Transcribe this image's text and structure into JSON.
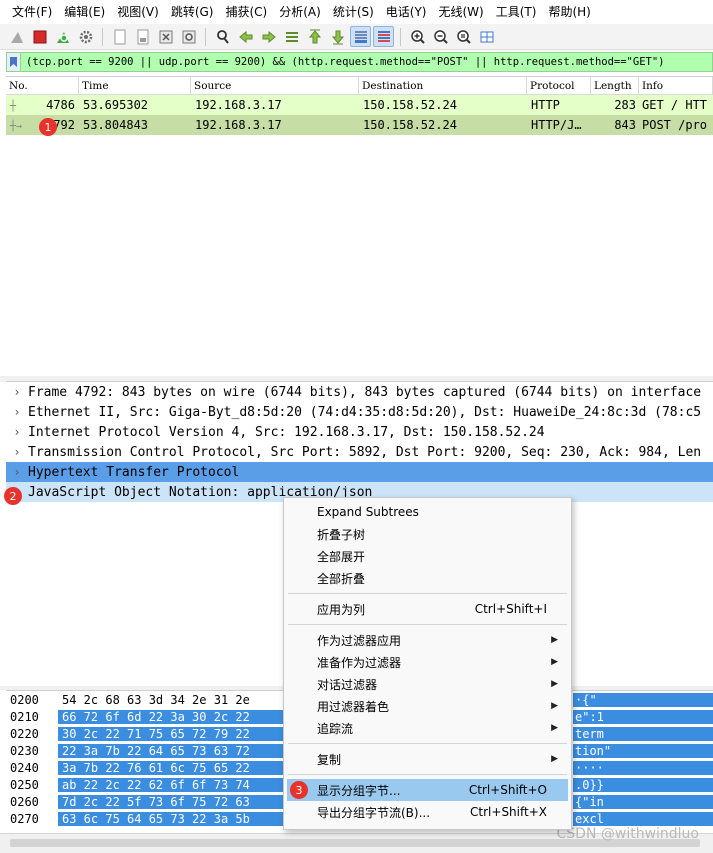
{
  "menubar": [
    "文件(F)",
    "编辑(E)",
    "视图(V)",
    "跳转(G)",
    "捕获(C)",
    "分析(A)",
    "统计(S)",
    "电话(Y)",
    "无线(W)",
    "工具(T)",
    "帮助(H)"
  ],
  "toolbar": {
    "icons": [
      "shark-fin-icon",
      "stop-icon",
      "restart-icon",
      "options-gear-icon",
      "open-file-icon",
      "save-file-icon",
      "close-file-icon",
      "reload-icon",
      "find-icon",
      "go-back-icon",
      "go-forward-icon",
      "go-to-packet-icon",
      "first-packet-icon",
      "last-packet-icon",
      "autoscroll-icon",
      "colorize-icon",
      "zoom-in-icon",
      "zoom-out-icon",
      "zoom-reset-icon",
      "resize-columns-icon"
    ]
  },
  "filter": {
    "text": "(tcp.port == 9200 || udp.port == 9200) && (http.request.method==\"POST\" ||  http.request.method==\"GET\")",
    "bg_color": "#afffaf"
  },
  "packet_list": {
    "columns": [
      "No.",
      "Time",
      "Source",
      "Destination",
      "Protocol",
      "Length",
      "Info"
    ],
    "rows": [
      {
        "no": "4786",
        "time": "53.695302",
        "source": "192.168.3.17",
        "destination": "150.158.52.24",
        "protocol": "HTTP",
        "length": "283",
        "info": "GET / HTT"
      },
      {
        "no": "4792",
        "time": "53.804843",
        "source": "192.168.3.17",
        "destination": "150.158.52.24",
        "protocol": "HTTP/J…",
        "length": "843",
        "info": "POST /pro"
      }
    ]
  },
  "details": [
    "Frame 4792: 843 bytes on wire (6744 bits), 843 bytes captured (6744 bits) on interface",
    "Ethernet II, Src: Giga-Byt_d8:5d:20 (74:d4:35:d8:5d:20), Dst: HuaweiDe_24:8c:3d (78:c5",
    "Internet Protocol Version 4, Src: 192.168.3.17, Dst: 150.158.52.24",
    "Transmission Control Protocol, Src Port: 5892, Dst Port: 9200, Seq: 230, Ack: 984, Len",
    "Hypertext Transfer Protocol",
    "JavaScript Object Notation: application/json"
  ],
  "bytes": [
    {
      "offset": "0200",
      "hex": "54 2c 68 63 3d 34 2e 31  2e",
      "ascii": "·{\""
    },
    {
      "offset": "0210",
      "hex": "66 72 6f 6d 22 3a 30 2c  22",
      "ascii": "e\":1"
    },
    {
      "offset": "0220",
      "hex": "30 2c 22 71 75 65 72 79  22",
      "ascii": "term"
    },
    {
      "offset": "0230",
      "hex": "22 3a 7b 22 64 65 73 63  72",
      "ascii": "tion\""
    },
    {
      "offset": "0240",
      "hex": "3a 7b 22 76 61 6c 75 65  22",
      "ascii": "····"
    },
    {
      "offset": "0250",
      "hex": "ab 22 2c 22 62 6f 6f 73  74",
      "ascii": ".0}}"
    },
    {
      "offset": "0260",
      "hex": "7d 2c 22 5f 73 6f 75 72  63",
      "ascii": "{\"in"
    },
    {
      "offset": "0270",
      "hex": "63 6c 75 64 65 73 22 3a  5b",
      "ascii": "excl"
    }
  ],
  "context_menu": {
    "items": [
      {
        "label": "Expand Subtrees",
        "shortcut": "",
        "submenu": false
      },
      {
        "label": "折叠子树",
        "shortcut": "",
        "submenu": false
      },
      {
        "label": "全部展开",
        "shortcut": "",
        "submenu": false
      },
      {
        "label": "全部折叠",
        "shortcut": "",
        "submenu": false
      },
      {
        "label": "应用为列",
        "shortcut": "Ctrl+Shift+I",
        "submenu": false
      },
      {
        "label": "作为过滤器应用",
        "shortcut": "",
        "submenu": true
      },
      {
        "label": "准备作为过滤器",
        "shortcut": "",
        "submenu": true
      },
      {
        "label": "对话过滤器",
        "shortcut": "",
        "submenu": true
      },
      {
        "label": "用过滤器着色",
        "shortcut": "",
        "submenu": true
      },
      {
        "label": "追踪流",
        "shortcut": "",
        "submenu": true
      },
      {
        "label": "复制",
        "shortcut": "",
        "submenu": true
      },
      {
        "label": "显示分组字节...",
        "shortcut": "Ctrl+Shift+O",
        "submenu": false
      },
      {
        "label": "导出分组字节流(B)...",
        "shortcut": "Ctrl+Shift+X",
        "submenu": false
      }
    ]
  },
  "badges": [
    "1",
    "2",
    "3"
  ],
  "watermark": "CSDN @withwindluo",
  "colors": {
    "row1": "#e4ffc7",
    "row2": "#c6dea5",
    "detail_selected": "#5a9ee8",
    "detail_selected_light": "#cce4f7",
    "menu_highlight": "#99c9ef",
    "badge": "#e8322c"
  }
}
